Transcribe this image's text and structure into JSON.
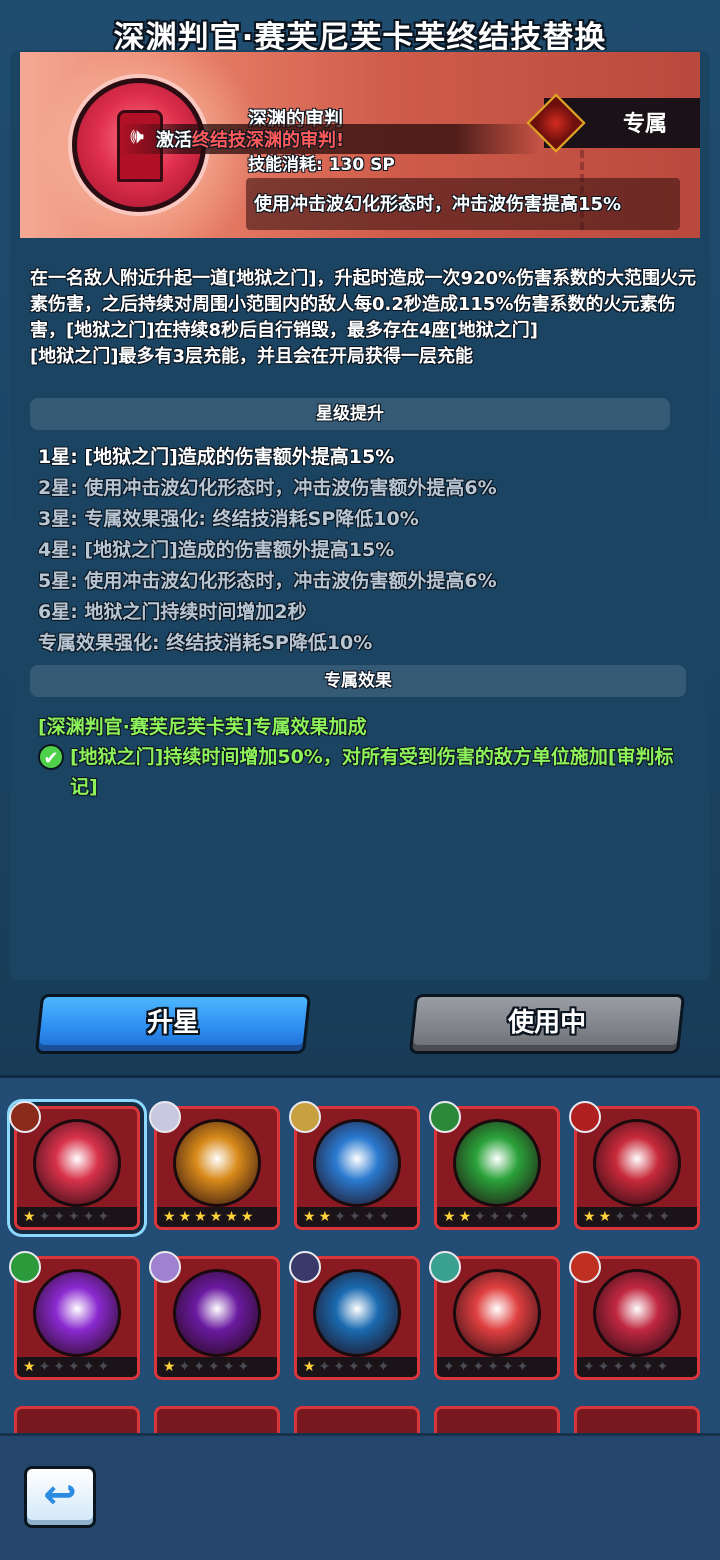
{
  "title": "深渊判官·赛芙尼芙卡芙终结技替换",
  "banner": {
    "skill_name": "深渊的审判",
    "skill_cost": "技能消耗: 130 SP",
    "toast_prefix": "激活",
    "toast_highlight": "终结技深渊的审判!",
    "exclusive_label": "专属",
    "effect_text": "使用冲击波幻化形态时，冲击波伤害提高15%"
  },
  "description": [
    "在一名敌人附近升起一道[地狱之门]，升起时造成一次920%伤害系数的大范围火元素伤害，之后持续对周围小范围内的敌人每0.2秒造成115%伤害系数的火元素伤害，[地狱之门]在持续8秒后自行销毁，最多存在4座[地狱之门]",
    "[地狱之门]最多有3层充能，并且会在开局获得一层充能"
  ],
  "star_section_title": "星级提升",
  "star_upgrades": [
    {
      "text": "1星: [地狱之门]造成的伤害额外提高15%",
      "active": true
    },
    {
      "text": "2星: 使用冲击波幻化形态时，冲击波伤害额外提高6%",
      "active": false
    },
    {
      "text": "3星: 专属效果强化: 终结技消耗SP降低10%",
      "active": false
    },
    {
      "text": "4星: [地狱之门]造成的伤害额外提高15%",
      "active": false
    },
    {
      "text": "5星: 使用冲击波幻化形态时，冲击波伤害额外提高6%",
      "active": false
    },
    {
      "text": "6星: 地狱之门持续时间增加2秒",
      "active": false
    },
    {
      "text": "专属效果强化: 终结技消耗SP降低10%",
      "active": false
    }
  ],
  "exclusive_section_title": "专属效果",
  "exclusive": {
    "title": "[深渊判官·赛芙尼芙卡芙]专属效果加成",
    "desc": "[地狱之门]持续时间增加50%，对所有受到伤害的敌方单位施加[审判标记]"
  },
  "buttons": {
    "upgrade": "升星",
    "in_use": "使用中"
  },
  "skills": [
    {
      "icon": "hell-gate-icon",
      "stars": 1,
      "orb": "#d8324a",
      "badge": "#8a2a1a",
      "selected": true
    },
    {
      "icon": "lightning-orb-icon",
      "stars": 6,
      "orb": "#d88a1a",
      "badge": "#c8c8e0"
    },
    {
      "icon": "ice-castle-icon",
      "stars": 2,
      "orb": "#2a7ad0",
      "badge": "#c8a040"
    },
    {
      "icon": "green-spirit-icon",
      "stars": 2,
      "orb": "#2aa23a",
      "badge": "#2a8a3a"
    },
    {
      "icon": "sword-strike-icon",
      "stars": 2,
      "orb": "#c82a3a",
      "badge": "#b02020"
    },
    {
      "icon": "void-vortex-icon",
      "stars": 1,
      "orb": "#8a2ad0",
      "badge": "#2a9a3a"
    },
    {
      "icon": "cauldron-icon",
      "stars": 1,
      "orb": "#6a1aa0",
      "badge": "#a080d0"
    },
    {
      "icon": "yin-yang-icon",
      "stars": 1,
      "orb": "#1a6ab0",
      "badge": "#3a3a6a"
    },
    {
      "icon": "mushroom-cloud-icon",
      "stars": 0,
      "orb": "#e04040",
      "badge": "#3aa090"
    },
    {
      "icon": "crimson-rune-icon",
      "stars": 0,
      "orb": "#c02840",
      "badge": "#c03020"
    }
  ]
}
